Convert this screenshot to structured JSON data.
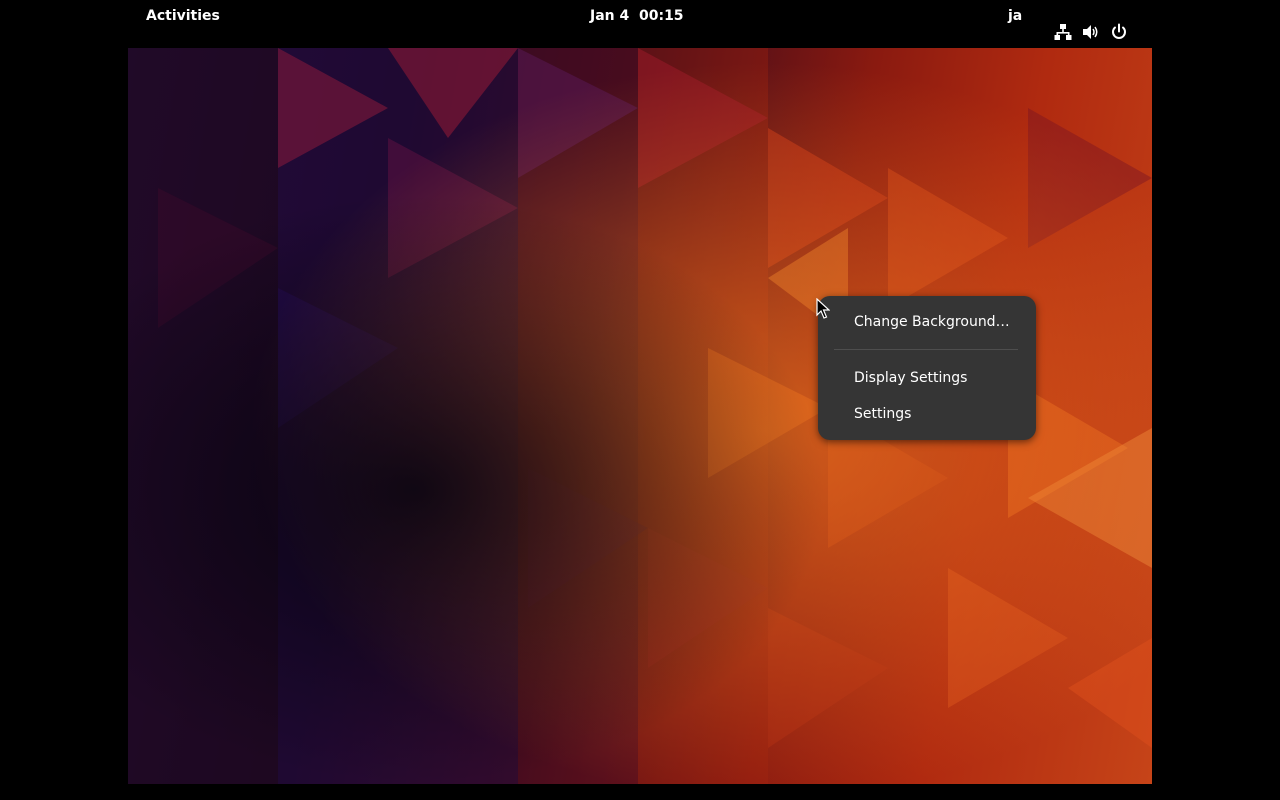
{
  "topbar": {
    "activities_label": "Activities",
    "clock_label": "Jan 4  00:15",
    "input_method_label": "ja",
    "tray_icons": [
      "network-wired-icon",
      "volume-icon",
      "power-icon"
    ]
  },
  "context_menu": {
    "items": [
      {
        "label": "Change Background…"
      },
      {
        "label": "Display Settings"
      },
      {
        "label": "Settings"
      }
    ]
  },
  "colors": {
    "panel_background": "#000000",
    "menu_background": "#353535",
    "menu_separator": "#4e4e4e",
    "text": "#ffffff"
  }
}
